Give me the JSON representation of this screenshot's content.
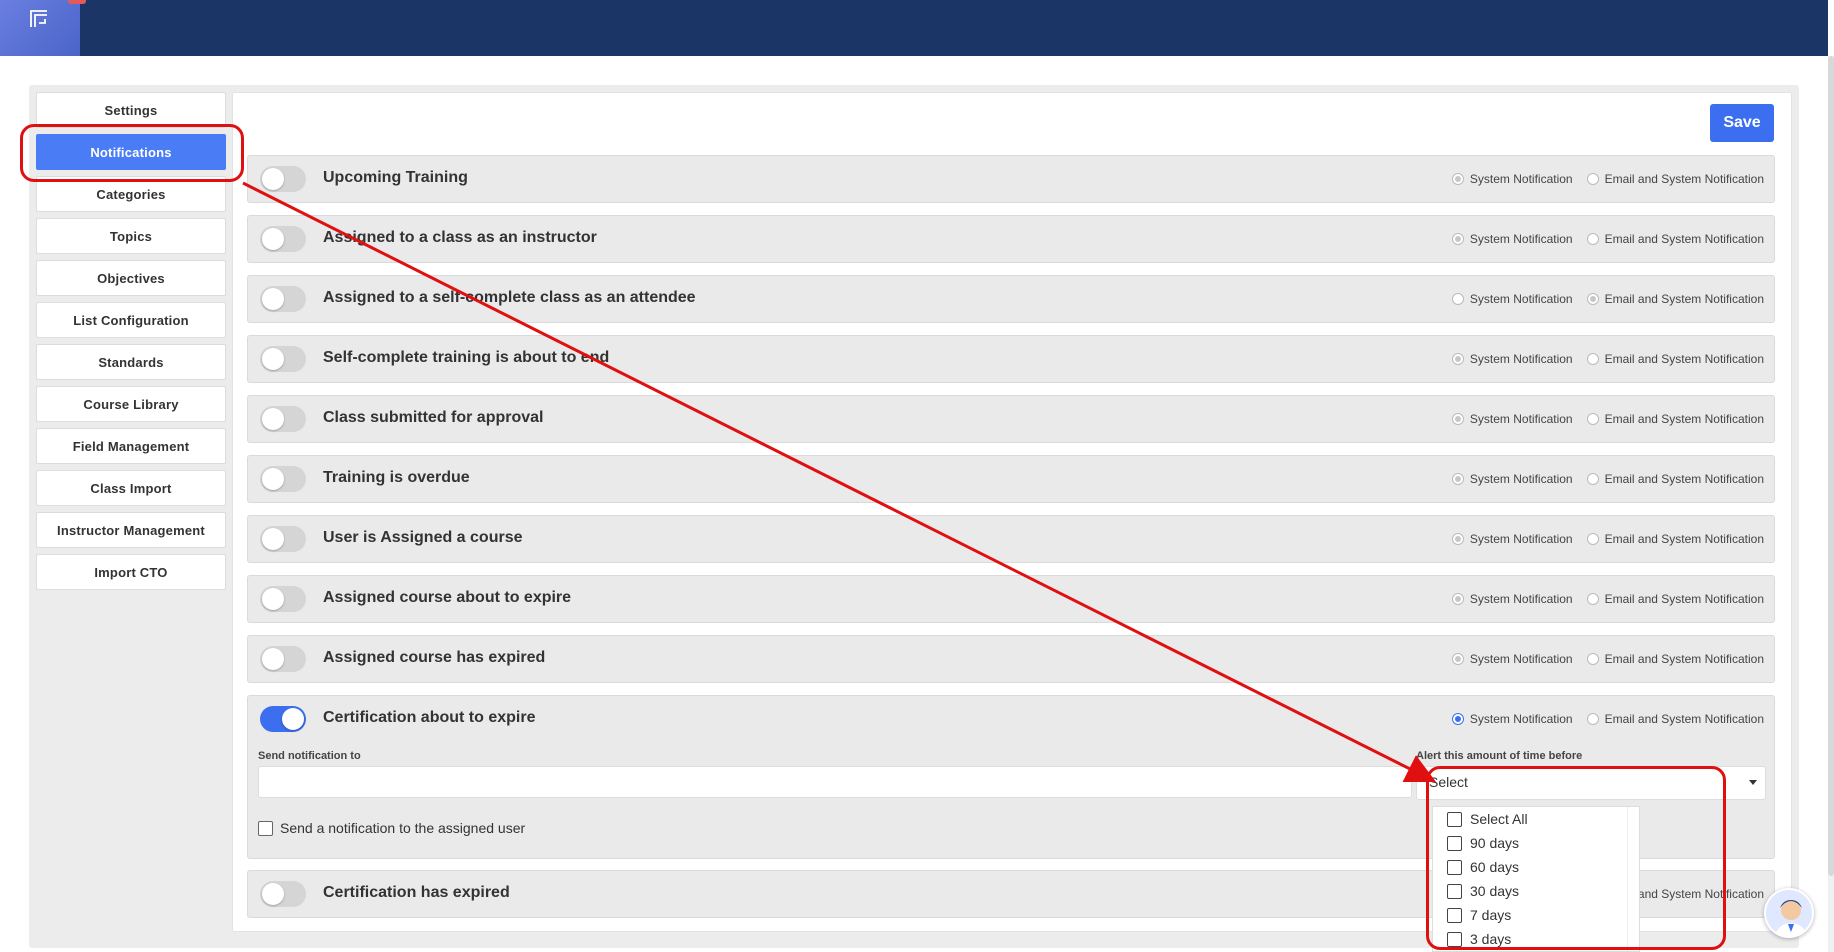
{
  "nav": {
    "items": [
      {
        "label": "Settings",
        "active": false
      },
      {
        "label": "Notifications",
        "active": true
      },
      {
        "label": "Categories",
        "active": false
      },
      {
        "label": "Topics",
        "active": false
      },
      {
        "label": "Objectives",
        "active": false
      },
      {
        "label": "List Configuration",
        "active": false
      },
      {
        "label": "Standards",
        "active": false
      },
      {
        "label": "Course Library",
        "active": false
      },
      {
        "label": "Field Management",
        "active": false
      },
      {
        "label": "Class Import",
        "active": false
      },
      {
        "label": "Instructor Management",
        "active": false
      },
      {
        "label": "Import CTO",
        "active": false
      }
    ]
  },
  "toolbar": {
    "save_label": "Save"
  },
  "radio_labels": {
    "system": "System Notification",
    "email": "Email and System Notification"
  },
  "notifications": [
    {
      "title": "Upcoming Training",
      "enabled": false,
      "selected": "system"
    },
    {
      "title": "Assigned to a class as an instructor",
      "enabled": false,
      "selected": "system"
    },
    {
      "title": "Assigned to a self-complete class as an attendee",
      "enabled": false,
      "selected": "email"
    },
    {
      "title": "Self-complete training is about to end",
      "enabled": false,
      "selected": "system"
    },
    {
      "title": "Class submitted for approval",
      "enabled": false,
      "selected": "system"
    },
    {
      "title": "Training is overdue",
      "enabled": false,
      "selected": "system"
    },
    {
      "title": "User is Assigned a course",
      "enabled": false,
      "selected": "system"
    },
    {
      "title": "Assigned course about to expire",
      "enabled": false,
      "selected": "system"
    },
    {
      "title": "Assigned course has expired",
      "enabled": false,
      "selected": "system"
    },
    {
      "title": "Certification about to expire",
      "enabled": true,
      "selected": "system"
    },
    {
      "title": "Certification has expired",
      "enabled": false,
      "selected": "system"
    }
  ],
  "expanded": {
    "send_to_label": "Send notification to",
    "send_to_value": "",
    "alert_label": "Alert this amount of time before",
    "alert_value": "Select",
    "assigned_user_label": "Send a notification to the assigned user",
    "options": [
      "Select All",
      "90 days",
      "60 days",
      "30 days",
      "7 days",
      "3 days"
    ]
  },
  "colors": {
    "topbar": "#1c3567",
    "accent": "#3b6ff0",
    "annotation": "#e01010"
  }
}
